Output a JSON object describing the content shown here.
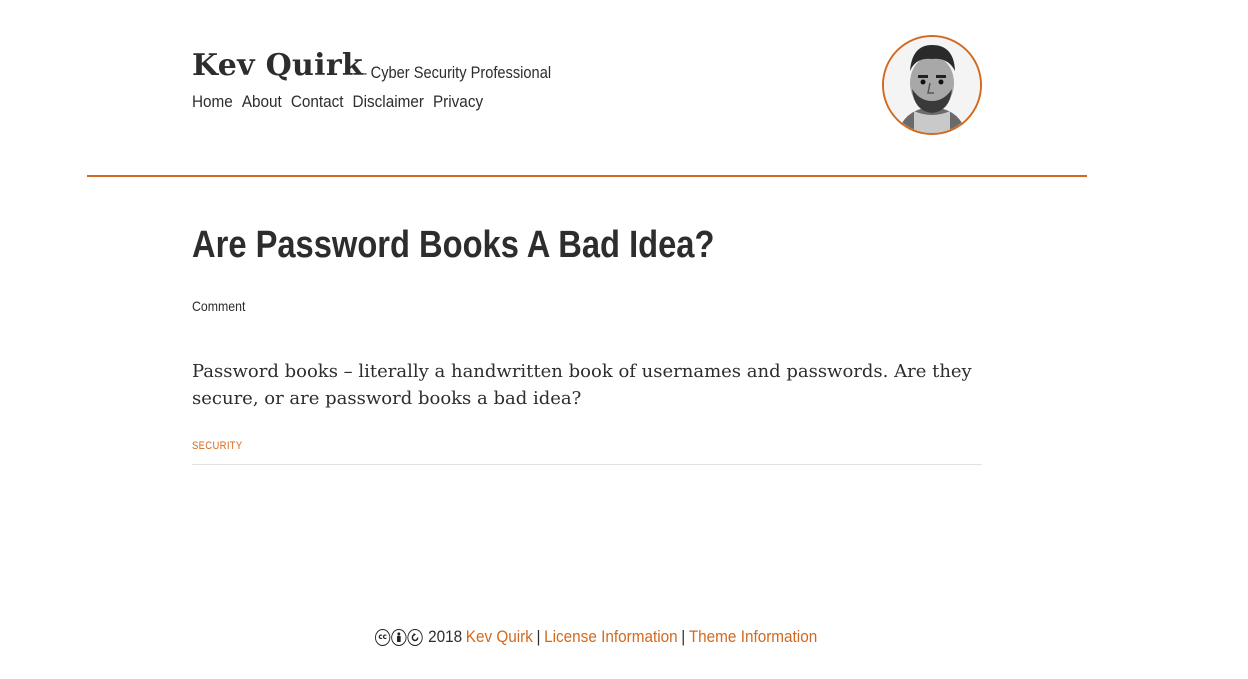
{
  "header": {
    "site_title": "Kev Quirk",
    "tagline": "— Cyber Security Professional",
    "nav": [
      {
        "label": "Home"
      },
      {
        "label": "About"
      },
      {
        "label": "Contact"
      },
      {
        "label": "Disclaimer"
      },
      {
        "label": "Privacy"
      }
    ]
  },
  "post": {
    "title": "Are Password Books A Bad Idea?",
    "comment_label": "Comment",
    "excerpt": "Password books – literally a handwritten book of usernames and passwords. Are they secure, or are password books a bad idea?",
    "category": "SECURITY"
  },
  "footer": {
    "year": "2018",
    "author_link": "Kev Quirk",
    "separator": "|",
    "license_link": "License Information",
    "theme_link": "Theme Information",
    "cc_icons": [
      "cc-icon",
      "by-icon",
      "sa-icon"
    ]
  },
  "colors": {
    "accent": "#d2691e",
    "text": "#2d2d2d",
    "rule_light": "#e2e2e2"
  }
}
